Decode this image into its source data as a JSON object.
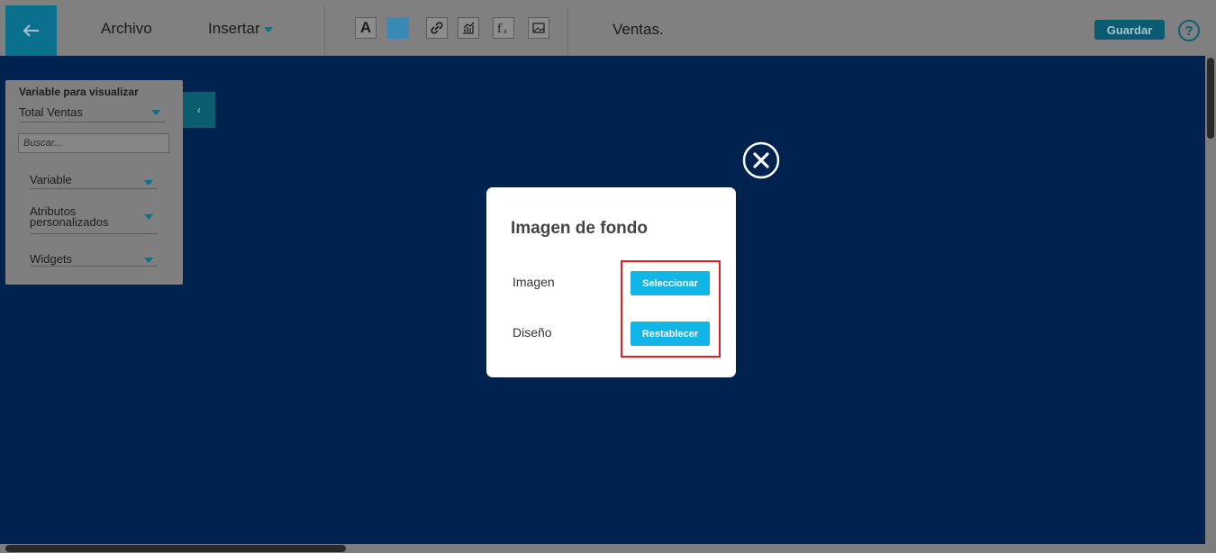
{
  "toolbar": {
    "back_icon": "arrow-left-icon",
    "menu_file": "Archivo",
    "menu_insert": "Insertar",
    "tools": [
      "text-icon",
      "color-swatch",
      "link-icon",
      "chart-icon",
      "function-icon",
      "image-icon"
    ],
    "tool_text_glyph": "A",
    "document_title": "Ventas.",
    "save_label": "Guardar",
    "help_glyph": "?"
  },
  "side_panel": {
    "title": "Variable para visualizar",
    "selected_variable": "Total Ventas",
    "search_placeholder": "Buscar...",
    "sections": [
      {
        "label": "Variable"
      },
      {
        "label_line1": "Atributos",
        "label_line2": "personalizados"
      },
      {
        "label": "Widgets"
      }
    ],
    "collapse_glyph": "‹"
  },
  "modal": {
    "title": "Imagen de fondo",
    "image_label": "Imagen",
    "select_button": "Seleccionar",
    "design_label": "Diseño",
    "reset_button": "Restablecer"
  },
  "colors": {
    "canvas_background": "#00224f",
    "accent": "#12b5e7",
    "highlight": "#e02020"
  }
}
